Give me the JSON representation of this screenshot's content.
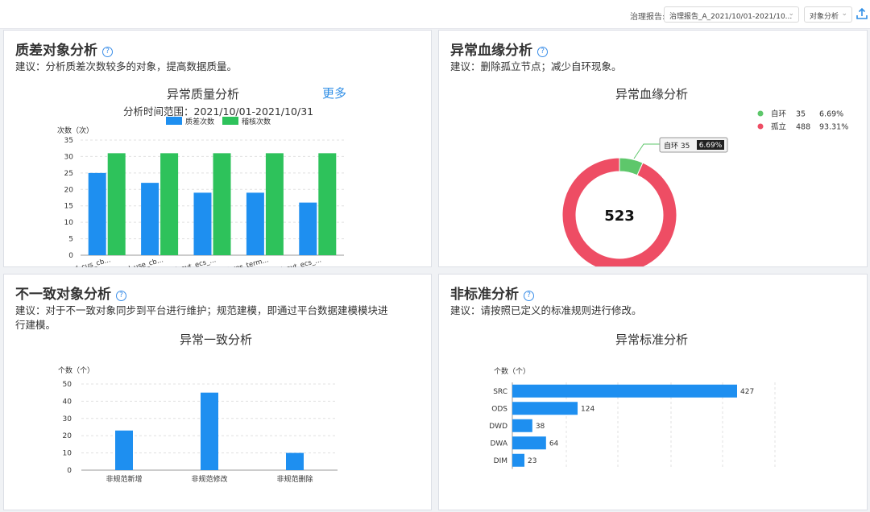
{
  "topbar": {
    "report_label": "治理报告:",
    "report_value": "治理报告_A_2021/10/01-2021/10...",
    "object_value": "对象分析",
    "chevron_icon": "chevron-down-icon",
    "upload_icon": "upload-icon"
  },
  "quality": {
    "title": "质差对象分析",
    "advice": "建议：分析质差次数较多的对象，提高数据质量。",
    "chart_title": "异常质量分析",
    "more": "更多",
    "range_label": "分析时间范围：2021/10/01-2021/10/31",
    "chart_data": {
      "type": "bar",
      "ylabel": "次数（次）",
      "ylim": [
        0,
        35
      ],
      "yticks": [
        0,
        5,
        10,
        15,
        20,
        25,
        30,
        35
      ],
      "categories": [
        "dwa_v_d_cus_cb...",
        "dwa_s_d_use_cb...",
        "dwd_d_evt_ecs_...",
        "dwa_d_res_term...",
        "dwd_d_evt_ecs_..."
      ],
      "series": [
        {
          "name": "质差次数",
          "color": "#1e8ff0",
          "values": [
            25,
            22,
            19,
            19,
            16
          ]
        },
        {
          "name": "稽核次数",
          "color": "#2ec25b",
          "values": [
            31,
            31,
            31,
            31,
            31
          ]
        }
      ]
    }
  },
  "lineage": {
    "title": "异常血缘分析",
    "advice": "建议：删除孤立节点；减少自环现象。",
    "chart_title": "异常血缘分析",
    "chart_data": {
      "type": "pie",
      "total": "523",
      "slices": [
        {
          "name": "自环",
          "value": 35,
          "percent": "6.69%",
          "color": "#5ec76b"
        },
        {
          "name": "孤立",
          "value": 488,
          "percent": "93.31%",
          "color": "#ee4d64"
        }
      ]
    }
  },
  "inconsistent": {
    "title": "不一致对象分析",
    "advice_line1": "建议：对于不一致对象同步到平台进行维护；规范建模，即通过平台数据建模模块进",
    "advice_line2": "行建模。",
    "chart_title": "异常一致分析",
    "chart_data": {
      "type": "bar",
      "ylabel": "个数（个）",
      "ylim": [
        0,
        50
      ],
      "yticks": [
        0,
        10,
        20,
        30,
        40,
        50
      ],
      "categories": [
        "非规范新增",
        "非规范修改",
        "非规范删除"
      ],
      "values": [
        23,
        45,
        10
      ],
      "color": "#1e8ff0"
    }
  },
  "nonstandard": {
    "title": "非标准分析",
    "advice": "建议：请按照已定义的标准规则进行修改。",
    "chart_title": "异常标准分析",
    "chart_data": {
      "type": "bar",
      "orientation": "horizontal",
      "ylabel": "个数（个）",
      "categories": [
        "SRC",
        "ODS",
        "DWD",
        "DWA",
        "DIM"
      ],
      "values": [
        427,
        124,
        38,
        64,
        23
      ],
      "color": "#1e8ff0"
    }
  }
}
